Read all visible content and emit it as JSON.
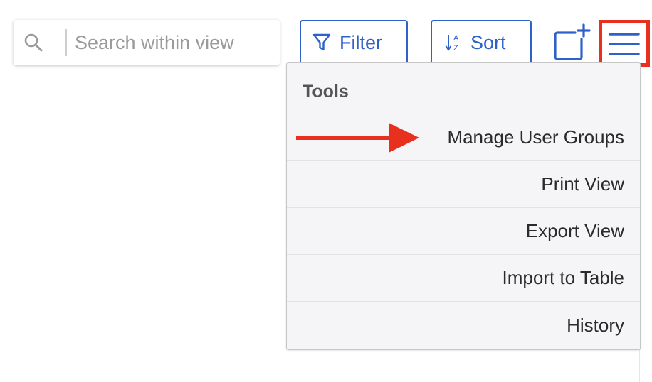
{
  "search": {
    "placeholder": "Search within view",
    "value": ""
  },
  "toolbar": {
    "filter_label": "Filter",
    "sort_label": "Sort",
    "sort_icon_glyphs": {
      "top": "A",
      "bottom": "Z"
    },
    "new_record_icon": "add-square-icon",
    "menu_icon": "hamburger-menu-icon"
  },
  "dropdown": {
    "heading": "Tools",
    "items": [
      {
        "label": "Manage User Groups"
      },
      {
        "label": "Print View"
      },
      {
        "label": "Export View"
      },
      {
        "label": "Import to Table"
      },
      {
        "label": "History"
      }
    ]
  },
  "annotation": {
    "type": "arrow",
    "points_to": "Manage User Groups",
    "color": "#e8301f"
  },
  "colors": {
    "accent": "#2f62c8",
    "highlight": "#e8301f",
    "menu_bg": "#f5f5f7"
  }
}
